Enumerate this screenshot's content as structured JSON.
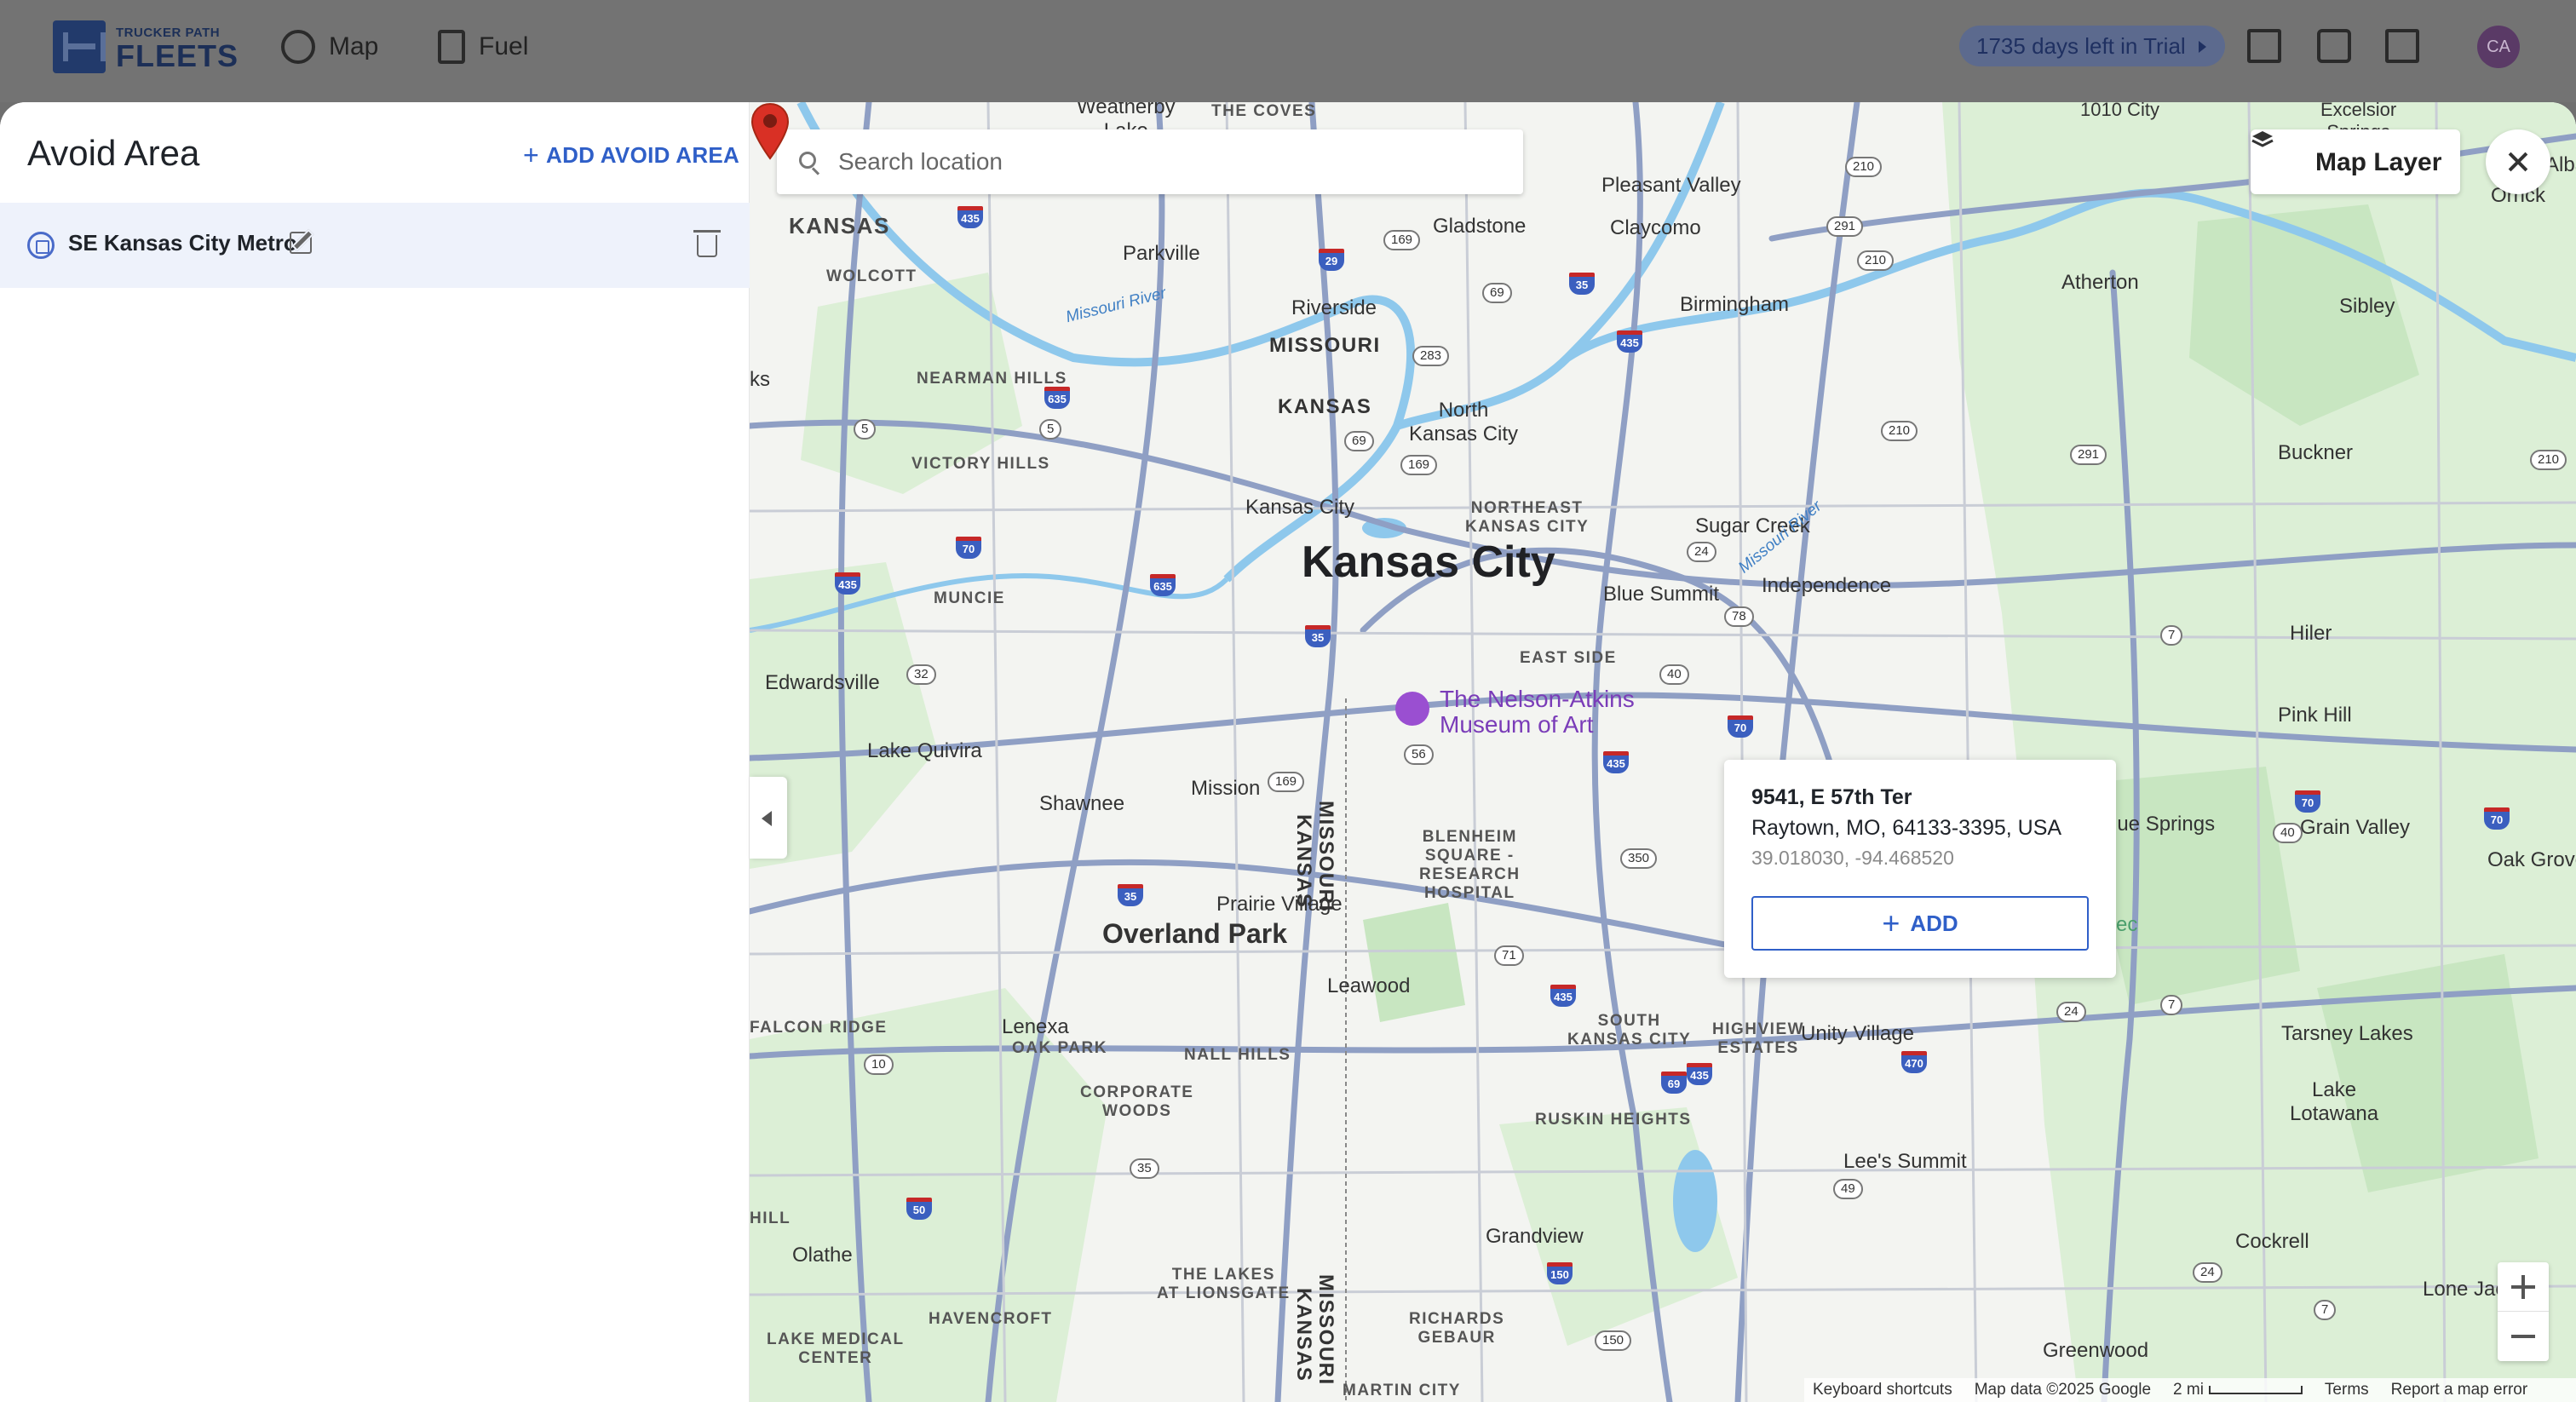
{
  "topbar": {
    "logo_small": "TRUCKER PATH",
    "logo_big": "FLEETS",
    "nav": [
      {
        "label": "Map",
        "icon": "globe-icon"
      },
      {
        "label": "Fuel",
        "icon": "fuel-pump-icon"
      }
    ],
    "trial_badge": "1735 days left in Trial",
    "icons": [
      "route-sign-icon",
      "chat-icon",
      "apps-grid-icon"
    ],
    "avatar_initials": "CA"
  },
  "panel": {
    "title": "Avoid Area",
    "add_button": "ADD AVOID AREA",
    "areas": [
      {
        "name": "SE Kansas City Metro"
      }
    ]
  },
  "map": {
    "search_placeholder": "Search location",
    "layer_button": "Map Layer",
    "popup": {
      "title": "9541, E 57th Ter",
      "address": "Raytown, MO, 64133-3395, USA",
      "coords": "39.018030, -94.468520",
      "add_button": "ADD"
    },
    "attribution": {
      "shortcuts": "Keyboard shortcuts",
      "data": "Map data ©2025 Google",
      "scale": "2 mi",
      "terms": "Terms",
      "report": "Report a map error"
    },
    "labels": {
      "kansas_city_big": "Kansas City",
      "overland_park": "Overland Park",
      "gladstone": "Gladstone",
      "pleasant_valley": "Pleasant Valley",
      "claycomo": "Claycomo",
      "parkville": "Parkville",
      "riverside": "Riverside",
      "missouri": "MISSOURI",
      "kansas": "KANSAS",
      "north_kc": "North\nKansas City",
      "kc_small": "Kansas City",
      "northeast_kc": "NORTHEAST\nKANSAS CITY",
      "sugar_creek": "Sugar Creek",
      "independence": "Independence",
      "blue_summit": "Blue Summit",
      "east_side": "EAST SIDE",
      "atherton": "Atherton",
      "birmingham": "Birmingham",
      "sibley": "Sibley",
      "buckner": "Buckner",
      "hiler": "Hiler",
      "pink_hill": "Pink Hill",
      "grain_valley": "Grain Valley",
      "oak_grove": "Oak Grove",
      "blue_springs": "lue Springs",
      "tarsney_lakes": "Tarsney Lakes",
      "lake_lotawana": "Lake\nLotawana",
      "lees_summit": "Lee's Summit",
      "cockrell": "Cockrell",
      "lone_jack": "Lone Jack",
      "greenwood": "Greenwood",
      "unity_village": "Unity Village",
      "highview_estates": "HIGHVIEW\nESTATES",
      "south_kc": "SOUTH\nKANSAS CITY",
      "ruskin_heights": "RUSKIN HEIGHTS",
      "grandview": "Grandview",
      "richards_gebaur": "RICHARDS\nGEBAUR",
      "martin_city": "MARTIN CITY",
      "leawood": "Leawood",
      "prairie_village": "Prairie Village",
      "mission": "Mission",
      "shawnee": "Shawnee",
      "lake_quivira": "Lake Quivira",
      "edwardsville": "Edwardsville",
      "muncie": "MUNCIE",
      "victory_hills": "VICTORY HILLS",
      "nearman_hills": "NEARMAN HILLS",
      "wolcott": "WOLCOTT",
      "kansas_top": "KANSAS",
      "lenexa": "Lenexa",
      "oak_park": "OAK PARK",
      "nall_hills": "NALL HILLS",
      "corporate_woods": "CORPORATE\nWOODS",
      "falcon_ridge": "FALCON RIDGE",
      "olathe": "Olathe",
      "lakes_lionsgate": "THE LAKES\nAT LIONSGATE",
      "blue_hill": "HILL",
      "havencroft": "HAVENCROFT",
      "lake_medical": "LAKE MEDICAL\nCENTER",
      "blenheim": "BLENHEIM\nSQUARE -\nRESEARCH\nHOSPITAL",
      "nelson_atkins": "The Nelson-Atkins\nMuseum of Art",
      "missouri_river_1": "Missouri River",
      "missouri_river_2": "Missouri River",
      "state_line_1": "MISSOURI",
      "state_line_2": "KANSAS",
      "weatherby": "Weatherby\nLake",
      "the_coves": "THE COVES",
      "orrick": "Orrick",
      "alba": "Alba",
      "excelsior": "Excelsior\nSprings",
      "lake_kc": "1010 City",
      "ks": "ks",
      "ks2": "ks",
      "ec": "ec"
    },
    "shields": [
      "435",
      "29",
      "169",
      "35",
      "69",
      "283",
      "635",
      "435",
      "210",
      "210",
      "291",
      "5",
      "5",
      "70",
      "435",
      "635",
      "35",
      "69",
      "169",
      "24",
      "78",
      "32",
      "40",
      "70",
      "56",
      "435",
      "7",
      "70",
      "40",
      "70",
      "35",
      "169",
      "350",
      "71",
      "435",
      "7",
      "470",
      "470",
      "435",
      "10",
      "69",
      "35",
      "50",
      "49",
      "150",
      "150",
      "7",
      "24",
      "24",
      "291",
      "210",
      "210"
    ]
  },
  "colors": {
    "accent": "#2f5fc8",
    "marker": "#d93025",
    "poi": "#7a3cb8"
  }
}
